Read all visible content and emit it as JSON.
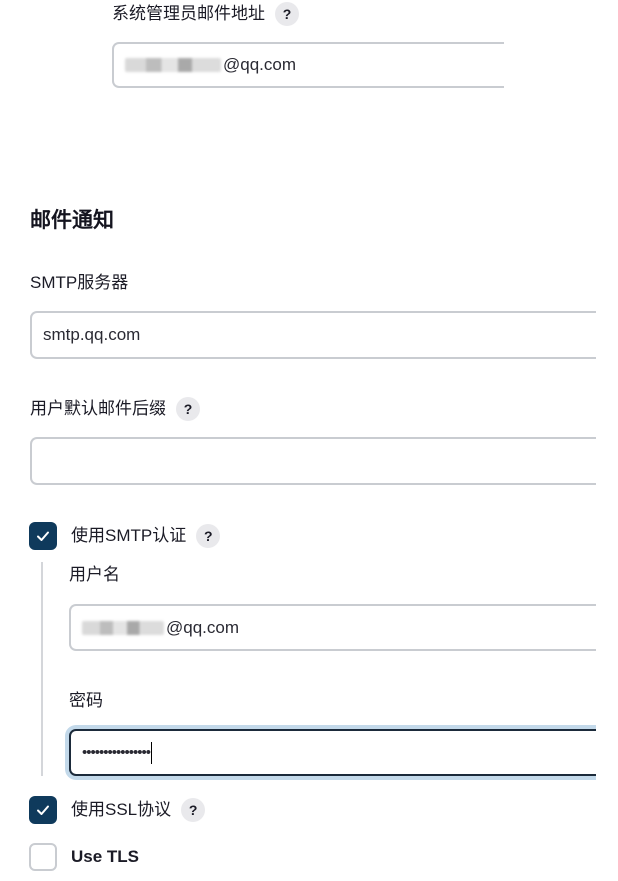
{
  "admin_email": {
    "label": "系统管理员邮件地址",
    "value_suffix": "@qq.com"
  },
  "mail_section": {
    "title": "邮件通知",
    "smtp_server": {
      "label": "SMTP服务器",
      "value": "smtp.qq.com"
    },
    "default_suffix": {
      "label": "用户默认邮件后缀",
      "value": ""
    },
    "use_smtp_auth": {
      "label": "使用SMTP认证",
      "checked": true
    },
    "username": {
      "label": "用户名",
      "value_suffix": "@qq.com"
    },
    "password": {
      "label": "密码",
      "value": "••••••••••••••••"
    },
    "use_ssl": {
      "label": "使用SSL协议",
      "checked": true
    },
    "use_tls": {
      "label": "Use TLS",
      "checked": false
    }
  },
  "help_glyph": "?",
  "icons": {
    "help": "help-icon",
    "check": "checkmark-icon"
  },
  "colors": {
    "checkbox_checked": "#0f3a5c",
    "focus_ring": "#c3d9ea",
    "field_border": "#c9ccd1"
  }
}
